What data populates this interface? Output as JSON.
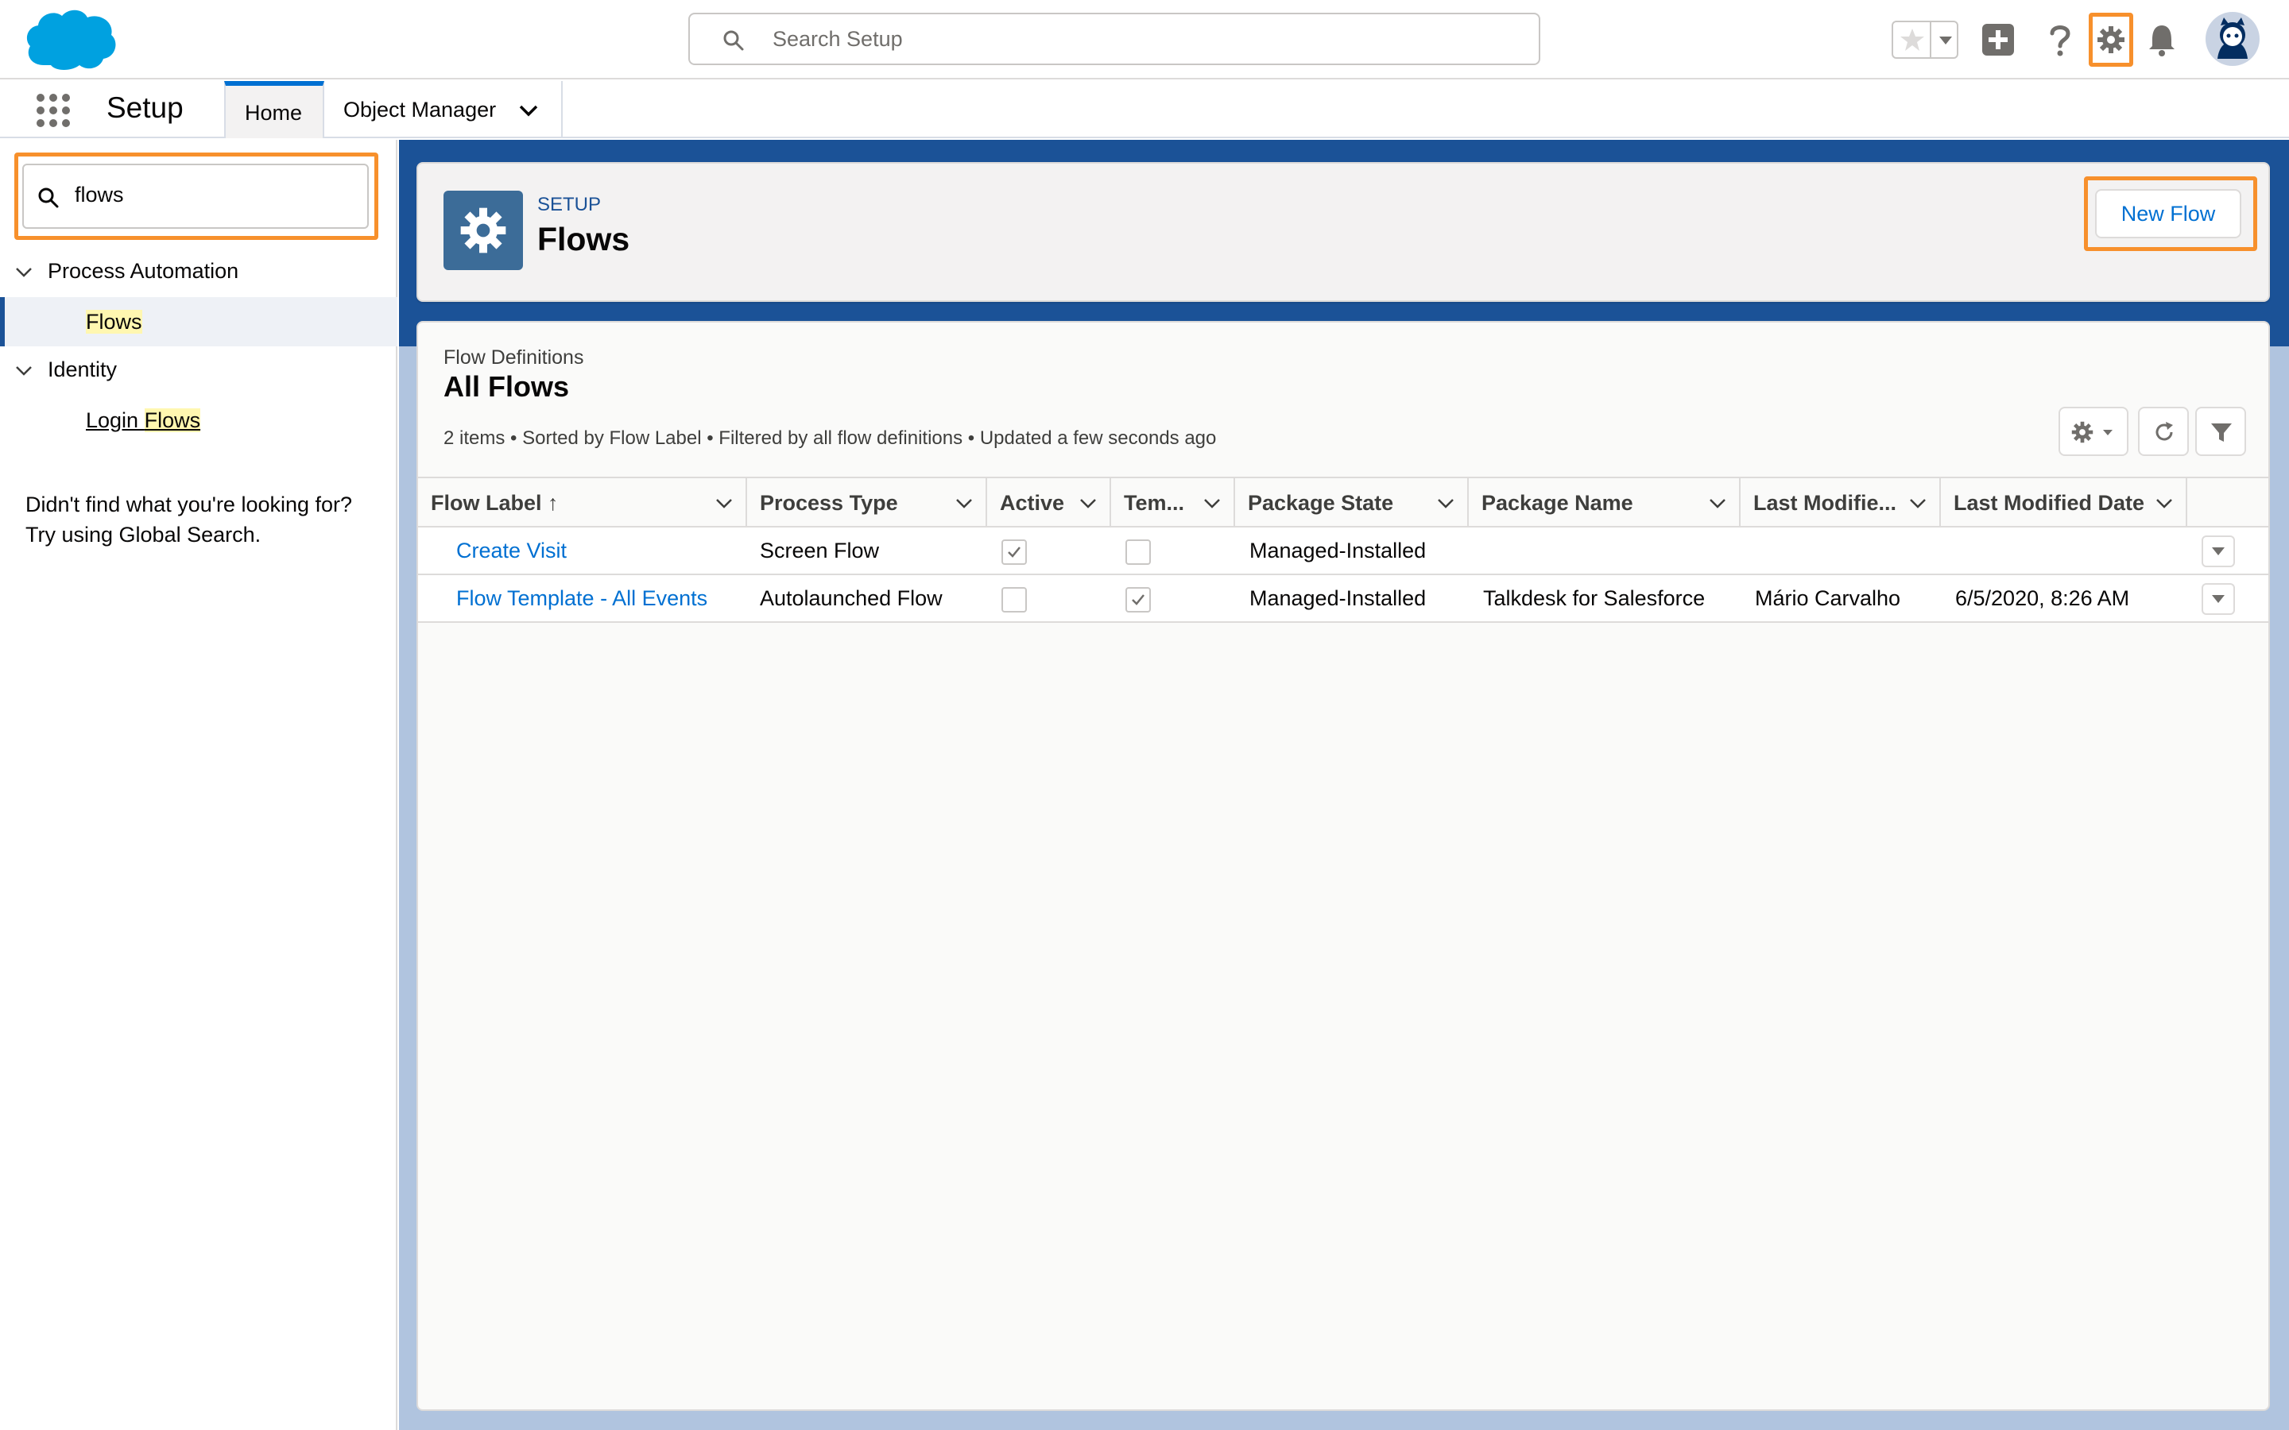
{
  "header": {
    "search_placeholder": "Search Setup",
    "icons": [
      "salesforce-cloud-logo",
      "search-icon",
      "favorites-star-icon",
      "favorites-caret-icon",
      "global-actions-plus-icon",
      "help-icon",
      "setup-gear-icon",
      "notifications-bell-icon",
      "user-avatar"
    ]
  },
  "context_bar": {
    "app_name": "Setup",
    "tabs": [
      {
        "label": "Home",
        "active": true
      },
      {
        "label": "Object Manager",
        "active": false
      }
    ]
  },
  "sidebar": {
    "quick_find_value": "flows",
    "tree": [
      {
        "label": "Process Automation",
        "children": [
          {
            "label_parts": [
              "",
              "Flows"
            ],
            "selected": true
          }
        ]
      },
      {
        "label": "Identity",
        "children": [
          {
            "label_parts": [
              "Login ",
              "Flows"
            ],
            "selected": false
          }
        ]
      }
    ],
    "hint_line1": "Didn't find what you're looking for?",
    "hint_line2": "Try using Global Search."
  },
  "page_header": {
    "eyebrow": "SETUP",
    "title": "Flows",
    "new_button": "New Flow"
  },
  "list_view": {
    "subtitle": "Flow Definitions",
    "title": "All Flows",
    "info": "2 items • Sorted by Flow Label • Filtered by all flow definitions • Updated a few seconds ago",
    "columns": [
      "Flow Label",
      "Process Type",
      "Active",
      "Tem...",
      "Package State",
      "Package Name",
      "Last Modifie...",
      "Last Modified Date"
    ],
    "sort_indicator": "↑",
    "rows": [
      {
        "flow_label": "Create Visit",
        "process_type": "Screen Flow",
        "active": true,
        "template": false,
        "package_state": "Managed-Installed",
        "package_name": "",
        "last_modified_by": "",
        "last_modified_date": ""
      },
      {
        "flow_label": "Flow Template - All Events",
        "process_type": "Autolaunched Flow",
        "active": false,
        "template": true,
        "package_state": "Managed-Installed",
        "package_name": "Talkdesk for Salesforce",
        "last_modified_by": "Mário Carvalho",
        "last_modified_date": "6/5/2020, 8:26 AM"
      }
    ]
  },
  "colors": {
    "brand_blue": "#1b5297",
    "link_blue": "#0070d2",
    "highlight_orange": "#f7902c",
    "search_highlight": "#fff7b0"
  }
}
